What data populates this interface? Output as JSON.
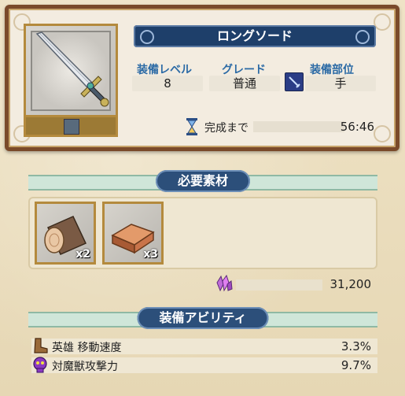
{
  "item": {
    "name": "ロングソード",
    "stats": [
      {
        "label": "装備レベル",
        "value": "8"
      },
      {
        "label": "グレード",
        "value": "普通"
      },
      {
        "label": "装備部位",
        "value": "手"
      }
    ],
    "timer_label": "完成まで",
    "timer_value": "56:46"
  },
  "materials": {
    "header": "必要素材",
    "items": [
      {
        "icon": "wood-log-icon",
        "count": "x2"
      },
      {
        "icon": "copper-ingot-icon",
        "count": "x3"
      }
    ],
    "gold_value": "31,200"
  },
  "abilities": {
    "header": "装備アビリティ",
    "items": [
      {
        "icon": "boot-icon",
        "label": "英雄 移動速度",
        "value": "3.3%"
      },
      {
        "icon": "beast-skull-icon",
        "label": "対魔獣攻撃力",
        "value": "9.7%"
      }
    ]
  },
  "colors": {
    "header_blue": "#1e3f6a",
    "label_blue": "#2b6aa5",
    "frame_brown": "#7a4a2a",
    "frame_gold": "#b48a3d"
  }
}
